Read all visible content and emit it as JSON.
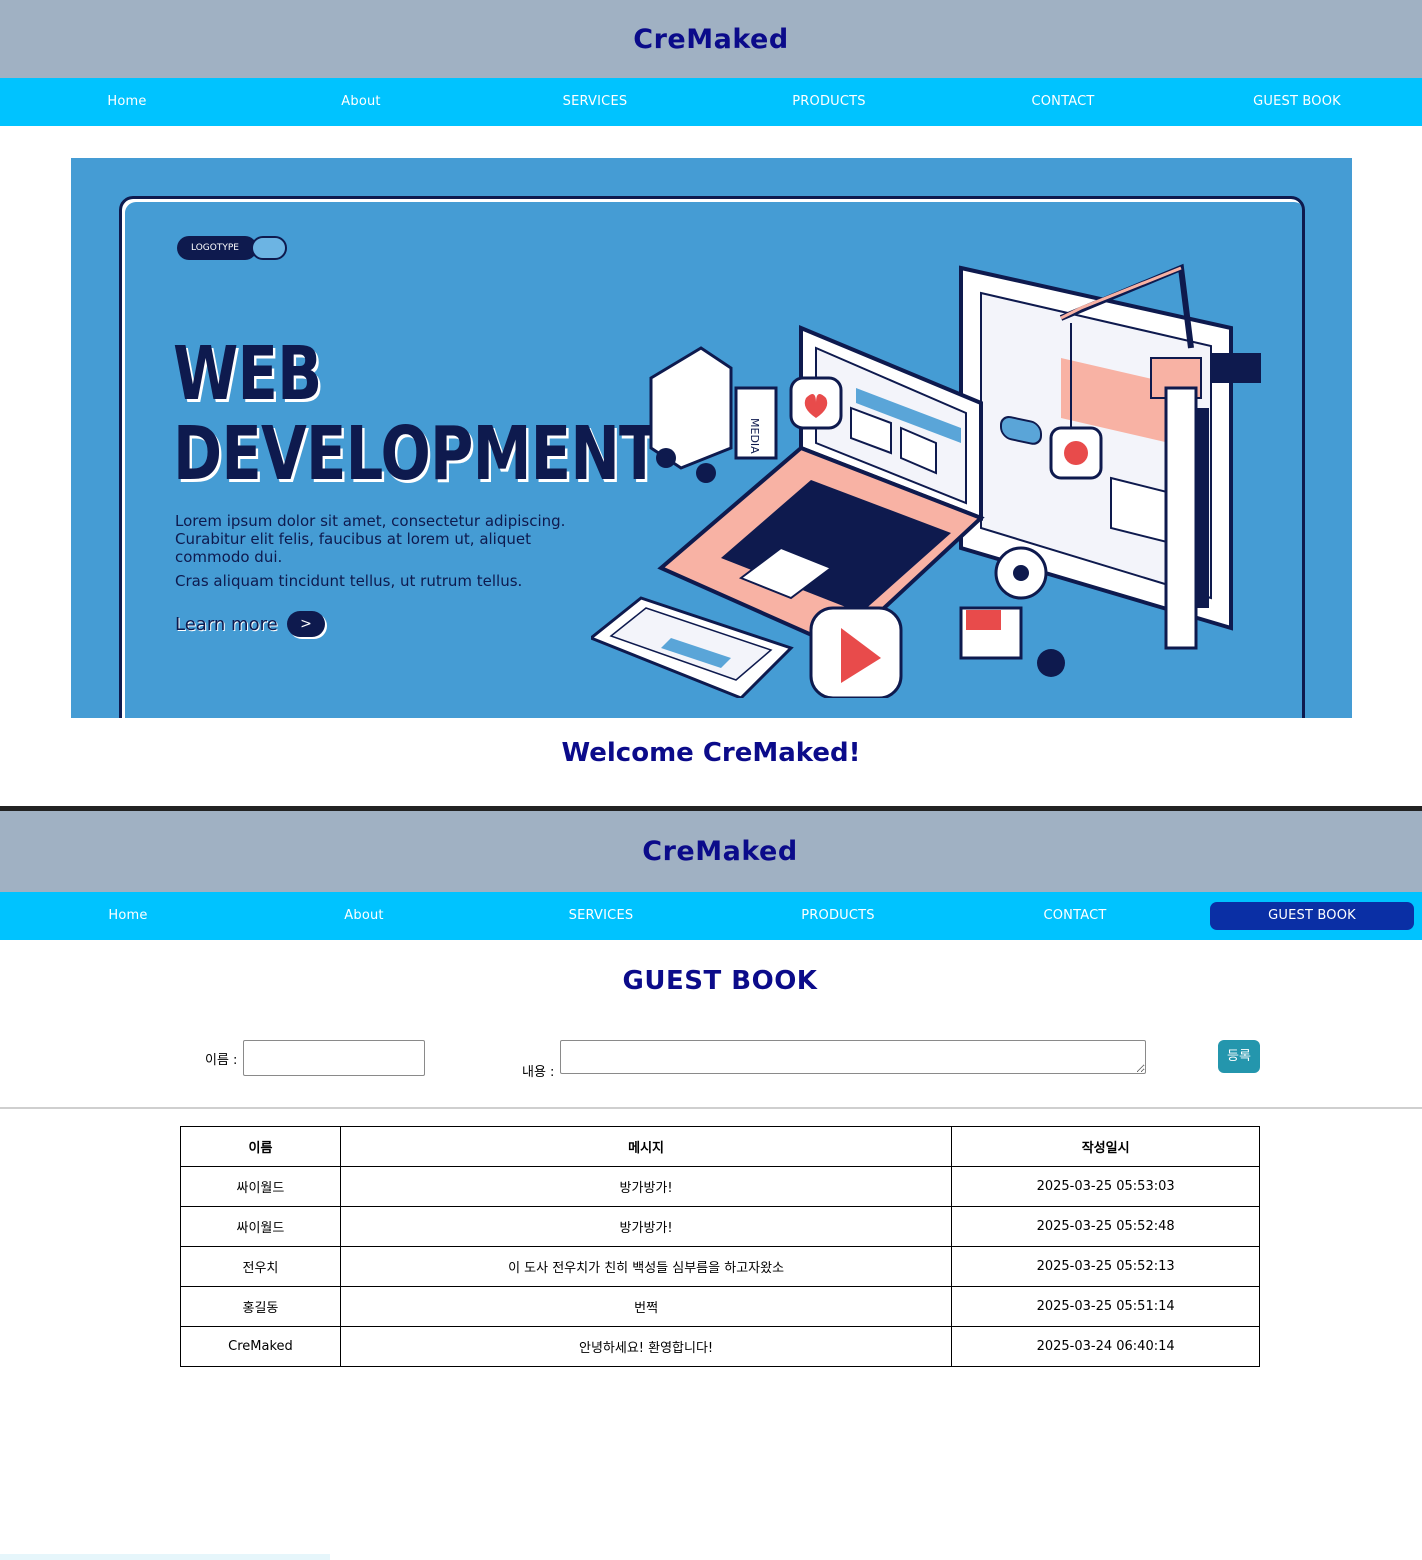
{
  "brand": "CreMaked",
  "nav": [
    "Home",
    "About",
    "SERVICES",
    "PRODUCTS",
    "CONTACT",
    "GUEST BOOK"
  ],
  "active_nav": "GUEST BOOK",
  "hero": {
    "logotype": "LOGOTYPE",
    "title_line1": "WEB",
    "title_line2": "DEVELOPMENT",
    "text1": "Lorem ipsum dolor sit amet, consectetur adipiscing. Curabitur elit felis, faucibus at lorem ut, aliquet commodo dui.",
    "text2": "Cras aliquam tincidunt tellus, ut rutrum tellus.",
    "learn_more": "Learn more",
    "learn_btn": ">",
    "media_label": "MEDIA"
  },
  "welcome": "Welcome CreMaked!",
  "guestbook": {
    "title": "GUEST BOOK",
    "name_label": "이름 :",
    "content_label": "내용 :",
    "submit": "등록",
    "headers": [
      "이름",
      "메시지",
      "작성일시"
    ],
    "rows": [
      [
        "싸이월드",
        "방가방가!",
        "2025-03-25 05:53:03"
      ],
      [
        "싸이월드",
        "방가방가!",
        "2025-03-25 05:52:48"
      ],
      [
        "전우치",
        "이 도사 전우치가 친히 백성들 심부름을 하고자왔소",
        "2025-03-25 05:52:13"
      ],
      [
        "홍길동",
        "번쩍",
        "2025-03-25 05:51:14"
      ],
      [
        "CreMaked",
        "안녕하세요! 환영합니다!",
        "2025-03-24 06:40:14"
      ]
    ]
  },
  "colors": {
    "header_bg": "#a0b1c3",
    "nav_bg": "#00c3ff",
    "nav_active": "#0a2fa5",
    "brand": "#0b0b8a",
    "hero_bg": "#459cd4",
    "submit": "#2496ad"
  }
}
